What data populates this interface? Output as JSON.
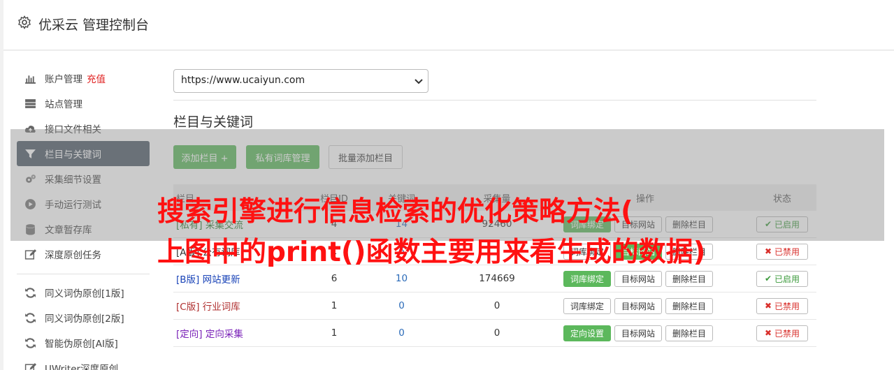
{
  "app": {
    "title": "优采云 管理控制台"
  },
  "sidebar": {
    "items": [
      {
        "label": "账户管理",
        "highlight": "充值",
        "icon": "bar-chart-icon"
      },
      {
        "label": "站点管理",
        "icon": "server-icon"
      },
      {
        "label": "接口文件相关",
        "icon": "cloud-upload-icon"
      },
      {
        "label": "栏目与关键词",
        "icon": "filter-icon",
        "active": true
      },
      {
        "label": "采集细节设置",
        "icon": "gears-icon"
      },
      {
        "label": "手动运行测试",
        "icon": "play-circle-icon"
      },
      {
        "label": "文章暂存库",
        "icon": "database-icon"
      },
      {
        "label": "深度原创任务",
        "icon": "edit-icon"
      }
    ],
    "items2": [
      {
        "label": "同义词伪原创[1版]",
        "icon": "refresh-icon"
      },
      {
        "label": "同义词伪原创[2版]",
        "icon": "refresh-icon"
      },
      {
        "label": "智能伪原创[AI版]",
        "icon": "refresh-icon"
      },
      {
        "label": "UWriter深度原创",
        "icon": "edit-icon"
      }
    ]
  },
  "site_select": {
    "value": "https://www.ucaiyun.com"
  },
  "section": {
    "title": "栏目与关键词"
  },
  "toolbar": {
    "add_column": "添加栏目 +",
    "private_lib": "私有词库管理",
    "batch_add": "批量添加栏目"
  },
  "table": {
    "headers": [
      "栏目",
      "栏目ID",
      "关键词",
      "采集量",
      "操作",
      "状态"
    ],
    "rows": [
      {
        "name": "[私有] 采集交流",
        "id": "4",
        "kw": "14",
        "count": "92460",
        "b1": "词库绑定",
        "b2": "目标网站",
        "b3": "删除栏目",
        "status": "已启用",
        "on": true
      },
      {
        "name": "[A版] 公有词库",
        "id": "1",
        "kw": "6",
        "count": "",
        "b1": "词库绑定",
        "b2": "目标网站",
        "b3": "删除栏目",
        "status": "已禁用",
        "on": false
      },
      {
        "name": "[B版] 网站更新",
        "id": "6",
        "kw": "10",
        "count": "174669",
        "b1": "词库绑定",
        "b2": "目标网站",
        "b3": "删除栏目",
        "status": "已启用",
        "on": true
      },
      {
        "name": "[C版] 行业词库",
        "id": "1",
        "kw": "0",
        "count": "0",
        "b1": "词库绑定",
        "b2": "目标网站",
        "b3": "删除栏目",
        "status": "已禁用",
        "on": false
      },
      {
        "name": "[定向] 定向采集",
        "id": "1",
        "kw": "0",
        "count": "0",
        "b1": "定向设置",
        "b2": "目标网站",
        "b3": "删除栏目",
        "status": "已禁用",
        "on": false
      }
    ]
  },
  "overlay": {
    "line1": "搜索引擎进行信息检索的优化策略方法(",
    "line2": "上图中的print()函数主要用来看生成的数据)"
  }
}
